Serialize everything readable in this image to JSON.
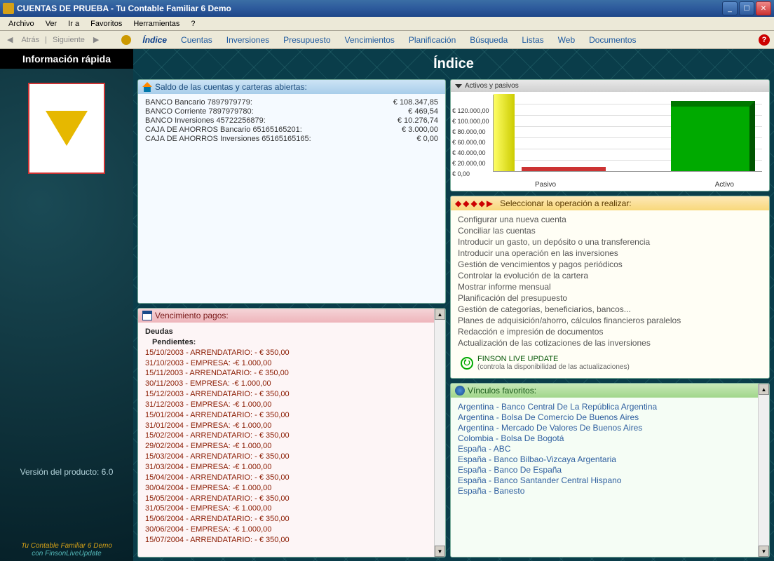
{
  "window": {
    "title": "CUENTAS DE PRUEBA - Tu Contable Familiar 6 Demo"
  },
  "menubar": [
    "Archivo",
    "Ver",
    "Ir a",
    "Favoritos",
    "Herramientas",
    "?"
  ],
  "toolbar": {
    "back": "Atrás",
    "forward": "Siguiente",
    "items": [
      "Índice",
      "Cuentas",
      "Inversiones",
      "Presupuesto",
      "Vencimientos",
      "Planificación",
      "Búsqueda",
      "Listas",
      "Web",
      "Documentos"
    ],
    "active_index": 0
  },
  "sidebar": {
    "header": "Información rápida",
    "version": "Versión del producto: 6.0",
    "footer1": "Tu Contable Familiar 6 Demo",
    "footer2": "con FinsonLiveUpdate"
  },
  "page_title": "Índice",
  "accounts_panel": {
    "title": "Saldo de las cuentas y carteras abiertas:",
    "rows": [
      {
        "name": "BANCO Bancario 7897979779:",
        "value": "€ 108.347,85"
      },
      {
        "name": "BANCO Corriente 7897979780:",
        "value": "€ 469,54"
      },
      {
        "name": "BANCO Inversiones 45722256879:",
        "value": "€ 10.276,74"
      },
      {
        "name": "CAJA DE AHORROS Bancario 65165165201:",
        "value": "€ 3.000,00"
      },
      {
        "name": "CAJA DE AHORROS Inversiones 65165165165:",
        "value": "€ 0,00"
      }
    ]
  },
  "chart_panel": {
    "title": "Activos y pasivos"
  },
  "chart_data": {
    "type": "bar",
    "categories": [
      "Pasivo",
      "Activo"
    ],
    "values": [
      5000,
      120000
    ],
    "ylabel": "€",
    "title": "Activos y pasivos",
    "ylim": [
      0,
      120000
    ],
    "yticks": [
      "€ 0,00",
      "€ 20.000,00",
      "€ 40.000,00",
      "€ 60.000,00",
      "€ 80.000,00",
      "€ 100.000,00",
      "€ 120.000,00"
    ],
    "colors": {
      "Pasivo": "#c33",
      "Activo": "#0a0"
    }
  },
  "ops_panel": {
    "title": "Seleccionar la operación a realizar:",
    "items": [
      "Configurar una nueva cuenta",
      "Conciliar las cuentas",
      "Introducir un gasto, un depósito o una transferencia",
      "Introducir una operación en las inversiones",
      "Gestión de vencimientos y pagos periódicos",
      "Controlar la evolución de la cartera",
      "Mostrar informe mensual",
      "Planificación del presupuesto",
      "Gestión de categorías, beneficiarios, bancos...",
      "Planes de adquisición/ahorro, cálculos financieros paralelos",
      "Redacción e impresión de documentos",
      "Actualización de las cotizaciones de las inversiones"
    ],
    "live_update_title": "FINSON LIVE UPDATE",
    "live_update_sub": "(controla la disponibilidad de las actualizaciones)"
  },
  "payments_panel": {
    "title": "Vencimiento pagos:",
    "heading1": "Deudas",
    "heading2": "Pendientes:",
    "rows": [
      "15/10/2003 - ARRENDATARIO:  - € 350,00",
      "31/10/2003 - EMPRESA:  -€ 1.000,00",
      "15/11/2003 - ARRENDATARIO:  - € 350,00",
      "30/11/2003 - EMPRESA:  -€ 1.000,00",
      "15/12/2003 - ARRENDATARIO:  - € 350,00",
      "31/12/2003 - EMPRESA:  -€ 1.000,00",
      "15/01/2004 - ARRENDATARIO:  - € 350,00",
      "31/01/2004 - EMPRESA:  -€ 1.000,00",
      "15/02/2004 - ARRENDATARIO:  - € 350,00",
      "29/02/2004 - EMPRESA:  -€ 1.000,00",
      "15/03/2004 - ARRENDATARIO:  - € 350,00",
      "31/03/2004 - EMPRESA:  -€ 1.000,00",
      "15/04/2004 - ARRENDATARIO:  - € 350,00",
      "30/04/2004 - EMPRESA:  -€ 1.000,00",
      "15/05/2004 - ARRENDATARIO:  - € 350,00",
      "31/05/2004 - EMPRESA:  -€ 1.000,00",
      "15/06/2004 - ARRENDATARIO:  - € 350,00",
      "30/06/2004 - EMPRESA:  -€ 1.000,00",
      "15/07/2004 - ARRENDATARIO:  - € 350,00"
    ]
  },
  "favs_panel": {
    "title": "Vínculos favoritos:",
    "items": [
      "Argentina - Banco Central De La República Argentina",
      "Argentina - Bolsa De Comercio De Buenos Aires",
      "Argentina - Mercado De Valores De Buenos Aires",
      "Colombia - Bolsa De Bogotá",
      "España - ABC",
      "España - Banco Bilbao-Vizcaya Argentaria",
      "España - Banco De España",
      "España - Banco Santander Central Hispano",
      "España - Banesto"
    ]
  }
}
